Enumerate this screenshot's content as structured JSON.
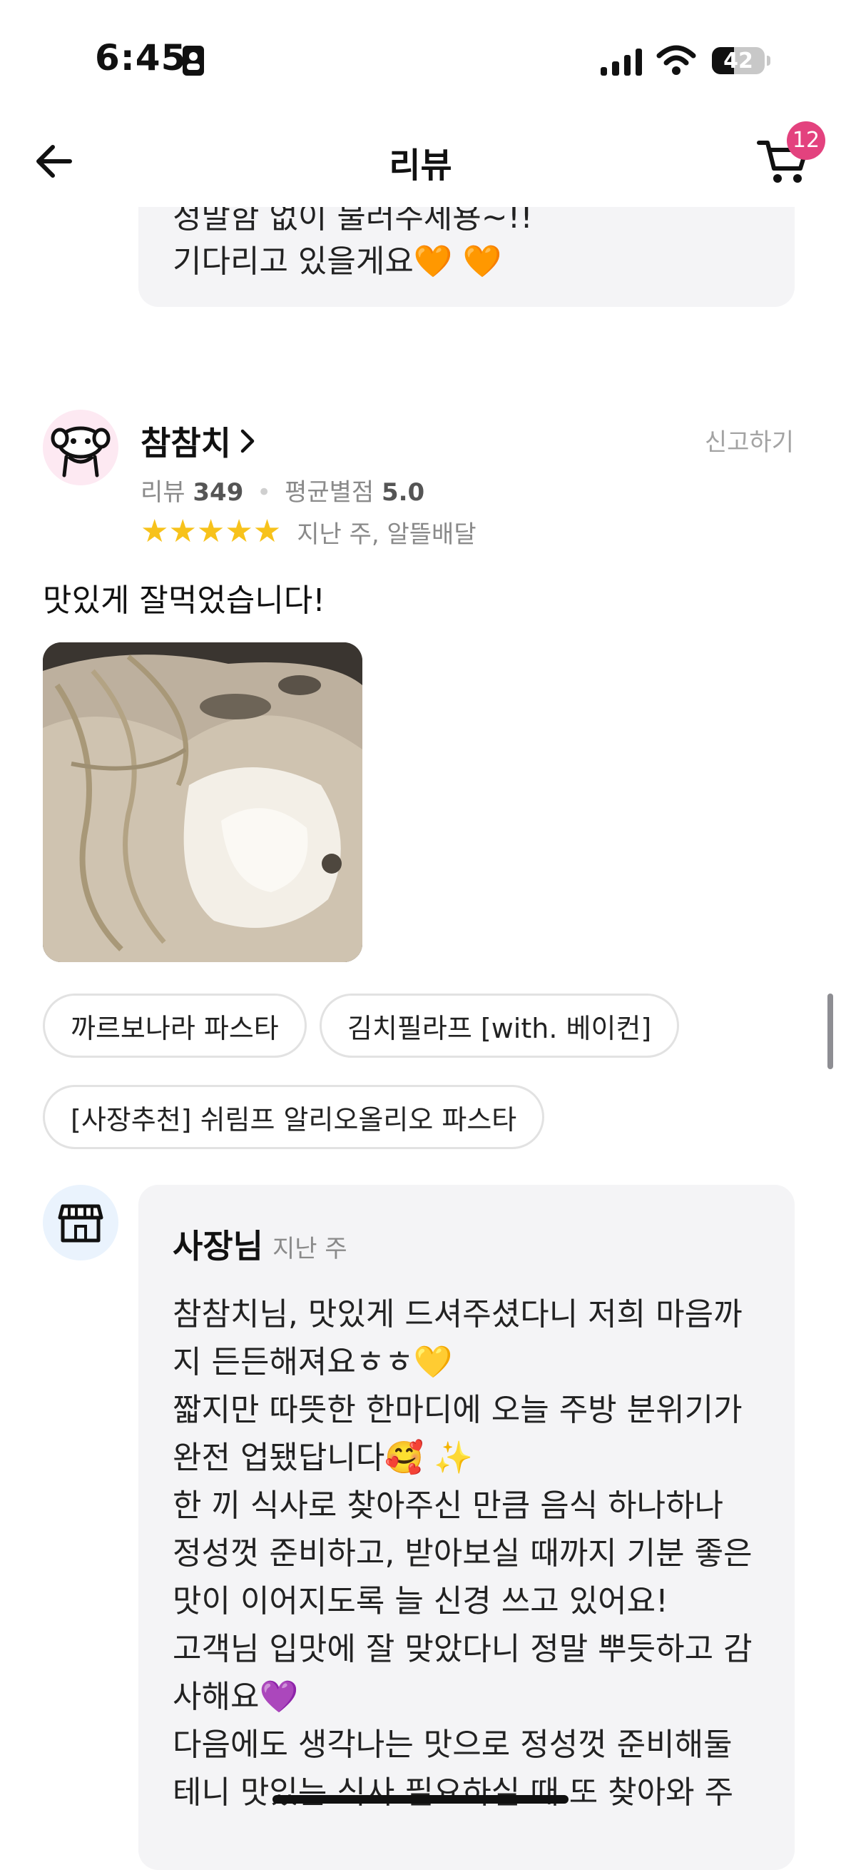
{
  "status_bar": {
    "time": "6:45",
    "battery": "42",
    "battery_level": 0.42
  },
  "header": {
    "title": "리뷰",
    "cart_count": "12"
  },
  "previous_reply": {
    "partial_line": "정말함 없이 불러주세용~!!",
    "last_line": "기다리고 있을게요🧡 🧡"
  },
  "review": {
    "nickname": "참참치",
    "report_label": "신고하기",
    "review_label": "리뷰",
    "review_count": "349",
    "avg_label": "평균별점",
    "avg_rating": "5.0",
    "stars": "★★★★★",
    "rating": 5,
    "sub_info": "지난 주, 알뜰배달",
    "text": "맛있게 잘먹었습니다!",
    "menu_tags": [
      "까르보나라 파스타",
      "김치필라프 [with. 베이컨]",
      "[사장추천] 쉬림프 알리오올리오 파스타"
    ]
  },
  "owner_reply": {
    "name": "사장님",
    "time": "지난 주",
    "lines": [
      "참참치님, 맛있게 드셔주셨다니 저희 마음까",
      "지 든든해져요ㅎㅎ💛",
      "짧지만 따뜻한 한마디에 오늘 주방 분위기가",
      "완전 업됐답니다🥰 ✨",
      "한 끼 식사로 찾아주신 만큼 음식 하나하나",
      "정성껏 준비하고, 받아보실 때까지 기분 좋은",
      "맛이 이어지도록 늘 신경 쓰고 있어요!",
      "고객님 입맛에 잘 맞았다니 정말 뿌듯하고 감",
      "사해요💜",
      "다음에도 생각나는 맛으로 정성껏 준비해둘",
      "테니 맛있는 식사 필요하실 때 또 찾아와 주"
    ]
  },
  "icons": {
    "back": "arrow-left-icon",
    "cart": "cart-icon",
    "chevron": "chevron-right-icon",
    "star": "star-icon",
    "store": "store-icon",
    "signal": "signal-icon",
    "wifi": "wifi-icon",
    "battery": "battery-icon",
    "contact": "contact-card-icon"
  },
  "colors": {
    "badge": "#e3427e",
    "star": "#f7c21b",
    "bubble": "#f4f4f6",
    "chip_border": "#e2e2e2"
  }
}
